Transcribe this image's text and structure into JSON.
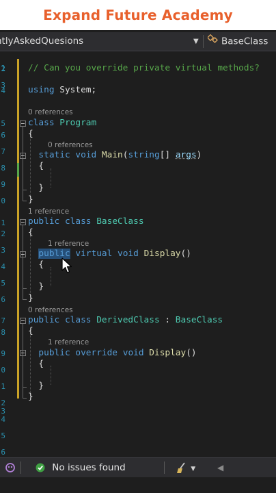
{
  "banner": {
    "title": "Expand Future Academy"
  },
  "navbar": {
    "file_label": "ntlyAskedQuesions",
    "class_label": "BaseClass"
  },
  "line_numbers": [
    "1",
    "2",
    "3",
    "4",
    "5",
    "6",
    "7",
    "8",
    "9",
    "0",
    "1",
    "2",
    "3",
    "4",
    "5",
    "6",
    "7",
    "8",
    "9",
    "0",
    "1",
    "2",
    "3",
    "4",
    "5",
    "6",
    "7"
  ],
  "code": {
    "comment": "// Can you override private virtual methods?",
    "using_kw": "using",
    "using_ns": "System;",
    "refs_program": "0 references",
    "program_kw": "class",
    "program_name": "Program",
    "refs_main": "0 references",
    "main_static": "static",
    "main_void": "void",
    "main_name": "Main",
    "main_paren_open": "(",
    "main_string": "string",
    "main_brackets": "[] ",
    "main_args": "args",
    "main_paren_close": ")",
    "refs_baseclass": "1 reference",
    "base_public": "public",
    "base_class_kw": "class",
    "base_name": "BaseClass",
    "refs_display_base": "1 reference",
    "display_public": "public",
    "display_virtual": "virtual",
    "display_void": "void",
    "display_name": "Display",
    "display_parens": "()",
    "refs_derived": "0 references",
    "derived_public": "public",
    "derived_class_kw": "class",
    "derived_name": "DerivedClass",
    "derived_colon": " : ",
    "derived_base": "BaseClass",
    "refs_display_derived": "1 reference",
    "override_public": "public",
    "override_kw": "override",
    "override_void": "void",
    "override_name": "Display",
    "override_parens": "()",
    "brace_open": "{",
    "brace_close": "}"
  },
  "statusbar": {
    "issues_text": "No issues found"
  },
  "colors": {
    "banner_text": "#e8602c",
    "keyword": "#569cd6",
    "type": "#4ec9b0",
    "method": "#dcdcaa",
    "comment": "#57a64a",
    "selection": "#264f78"
  }
}
